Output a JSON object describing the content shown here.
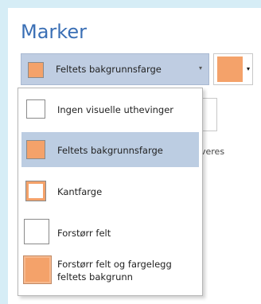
{
  "title": "Marker",
  "combo": {
    "selected_label": "Feltets bakgrunnsfarge",
    "arrow": "▾"
  },
  "color_button": {
    "color": "#f4a26a",
    "arrow": "▾"
  },
  "behind_text": "veres",
  "dropdown": {
    "options": [
      {
        "label": "Ingen visuelle uthevinger",
        "icon": "plain-box-icon"
      },
      {
        "label": "Feltets bakgrunnsfarge",
        "icon": "filled-box-icon"
      },
      {
        "label": "Kantfarge",
        "icon": "border-box-icon"
      },
      {
        "label": "Forstørr felt",
        "icon": "enlarged-box-icon"
      },
      {
        "label_line1": "Forstørr felt og fargelegg",
        "label_line2": "feltets bakgrunn",
        "icon": "enlarged-filled-box-icon"
      }
    ],
    "selected_index": 1
  },
  "colors": {
    "accent": "#3a6fb5",
    "highlight": "#f4a26a",
    "selection": "#bccde2"
  }
}
